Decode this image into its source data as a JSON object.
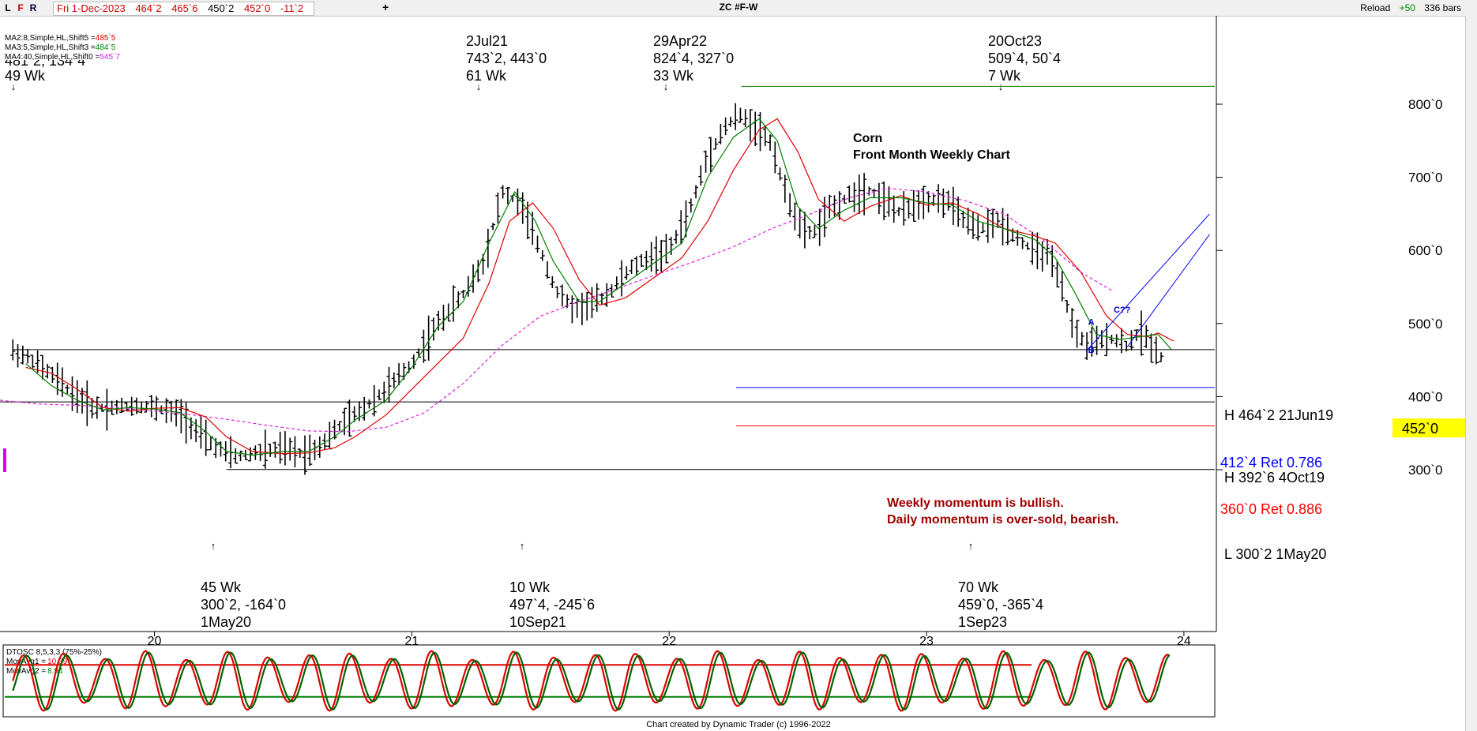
{
  "titlebar": {
    "buttons": [
      "L",
      "F",
      "R"
    ],
    "info": [
      "Fri 1-Dec-2023",
      "464`2",
      "465`6",
      "450`2",
      "452`0",
      "-11`2"
    ],
    "plus": "+",
    "title": "ZC #F-W",
    "reload": "Reload",
    "reload_count": "+50",
    "bars": "336 bars"
  },
  "ma_legend": [
    {
      "label": "MA2:8,Simple,HL,Shift5 =",
      "value": "485`5",
      "color": "#e00000"
    },
    {
      "label": "MA3:5,Simple,HL,Shift3 =",
      "value": "484`5",
      "color": "#008000"
    },
    {
      "label": "MA4:40,Simple,HL,Shift0 =",
      "value": "545`7",
      "color": "#e020e0"
    }
  ],
  "cut_label": "481`2, 134`4",
  "annotations": {
    "peaks": [
      {
        "lines": [
          "49 Wk"
        ]
      },
      {
        "lines": [
          "2Jul21",
          "743`2, 443`0",
          "61 Wk"
        ]
      },
      {
        "lines": [
          "29Apr22",
          "824`4, 327`0",
          "33 Wk"
        ]
      },
      {
        "lines": [
          "20Oct23",
          "509`4, 50`4",
          "7 Wk"
        ]
      }
    ],
    "troughs": [
      {
        "lines": [
          "45 Wk",
          "300`2, -164`0",
          "1May20"
        ]
      },
      {
        "lines": [
          "10 Wk",
          "497`4, -245`6",
          "10Sep21"
        ]
      },
      {
        "lines": [
          "70 Wk",
          "459`0, -365`4",
          "1Sep23"
        ]
      }
    ],
    "chart_text": [
      "Corn",
      "Front Month Weekly Chart"
    ],
    "momentum_text": [
      "Weekly momentum is bullish.",
      "Daily momentum is over-sold, bearish."
    ],
    "abc": [
      "A",
      "B",
      "C??"
    ]
  },
  "levels": [
    {
      "label": "H 464`2 21Jun19",
      "color": "#000000"
    },
    {
      "label": "412`4 Ret 0.786",
      "color": "#0000ff"
    },
    {
      "label": "H 392`6 4Oct19",
      "color": "#000000"
    },
    {
      "label": "360`0 Ret 0.886",
      "color": "#ff0000"
    },
    {
      "label": "L 300`2 1May20",
      "color": "#000000"
    }
  ],
  "price_marker": "452`0",
  "oscillator": {
    "label": "DTOSC 8,5,3,3 (75%-25%)",
    "avg1": {
      "label": "MovAvg1 =",
      "value": "10.39",
      "color": "#e00000"
    },
    "avg2": {
      "label": "MovAvg2 =",
      "value": "8.94",
      "color": "#008000"
    }
  },
  "footer": "Chart created by Dynamic Trader  (c) 1996-2022",
  "chart_data": {
    "type": "bar",
    "title": "ZC #F-W",
    "subtitle": "Corn Front Month Weekly Chart",
    "y_ticks": [
      "300`0",
      "400`0",
      "500`0",
      "600`0",
      "700`0",
      "800`0"
    ],
    "y_tick_values": [
      300,
      400,
      500,
      600,
      700,
      800
    ],
    "ylim": [
      230,
      880
    ],
    "x_labels": [
      "20",
      "21",
      "22",
      "23",
      "24"
    ],
    "x_label_values": [
      2020.0,
      2021.0,
      2022.0,
      2023.0,
      2024.0
    ],
    "xlim": [
      2019.4,
      2024.12
    ],
    "anchors": [
      [
        2019.45,
        462
      ],
      [
        2019.52,
        452
      ],
      [
        2019.6,
        430
      ],
      [
        2019.68,
        405
      ],
      [
        2019.76,
        385
      ],
      [
        2019.84,
        385
      ],
      [
        2019.92,
        388
      ],
      [
        2020.0,
        385
      ],
      [
        2020.1,
        375
      ],
      [
        2020.2,
        340
      ],
      [
        2020.28,
        322
      ],
      [
        2020.33,
        318
      ],
      [
        2020.42,
        325
      ],
      [
        2020.5,
        328
      ],
      [
        2020.58,
        322
      ],
      [
        2020.64,
        332
      ],
      [
        2020.72,
        360
      ],
      [
        2020.8,
        380
      ],
      [
        2020.9,
        410
      ],
      [
        2021.0,
        445
      ],
      [
        2021.1,
        500
      ],
      [
        2021.2,
        540
      ],
      [
        2021.28,
        585
      ],
      [
        2021.35,
        680
      ],
      [
        2021.42,
        665
      ],
      [
        2021.5,
        600
      ],
      [
        2021.56,
        545
      ],
      [
        2021.63,
        520
      ],
      [
        2021.69,
        525
      ],
      [
        2021.76,
        540
      ],
      [
        2021.85,
        575
      ],
      [
        2021.92,
        590
      ],
      [
        2022.0,
        600
      ],
      [
        2022.08,
        655
      ],
      [
        2022.15,
        730
      ],
      [
        2022.22,
        770
      ],
      [
        2022.27,
        785
      ],
      [
        2022.33,
        772
      ],
      [
        2022.4,
        745
      ],
      [
        2022.45,
        680
      ],
      [
        2022.52,
        625
      ],
      [
        2022.57,
        625
      ],
      [
        2022.62,
        655
      ],
      [
        2022.7,
        675
      ],
      [
        2022.78,
        683
      ],
      [
        2022.85,
        665
      ],
      [
        2022.9,
        650
      ],
      [
        2022.95,
        662
      ],
      [
        2023.0,
        670
      ],
      [
        2023.08,
        668
      ],
      [
        2023.15,
        640
      ],
      [
        2023.2,
        628
      ],
      [
        2023.28,
        640
      ],
      [
        2023.36,
        615
      ],
      [
        2023.42,
        598
      ],
      [
        2023.47,
        595
      ],
      [
        2023.52,
        555
      ],
      [
        2023.57,
        495
      ],
      [
        2023.62,
        470
      ],
      [
        2023.67,
        475
      ],
      [
        2023.72,
        480
      ],
      [
        2023.78,
        470
      ],
      [
        2023.83,
        490
      ],
      [
        2023.88,
        468
      ],
      [
        2023.92,
        452
      ]
    ],
    "ma8_shift5": [
      [
        2019.5,
        440
      ],
      [
        2019.6,
        432
      ],
      [
        2019.7,
        410
      ],
      [
        2019.8,
        385
      ],
      [
        2019.9,
        380
      ],
      [
        2020.0,
        384
      ],
      [
        2020.1,
        385
      ],
      [
        2020.2,
        372
      ],
      [
        2020.28,
        345
      ],
      [
        2020.38,
        325
      ],
      [
        2020.5,
        322
      ],
      [
        2020.6,
        323
      ],
      [
        2020.7,
        330
      ],
      [
        2020.78,
        345
      ],
      [
        2020.9,
        375
      ],
      [
        2021.0,
        410
      ],
      [
        2021.1,
        445
      ],
      [
        2021.2,
        480
      ],
      [
        2021.3,
        555
      ],
      [
        2021.38,
        640
      ],
      [
        2021.47,
        665
      ],
      [
        2021.55,
        630
      ],
      [
        2021.65,
        560
      ],
      [
        2021.73,
        525
      ],
      [
        2021.83,
        535
      ],
      [
        2021.95,
        565
      ],
      [
        2022.05,
        590
      ],
      [
        2022.15,
        640
      ],
      [
        2022.25,
        710
      ],
      [
        2022.35,
        765
      ],
      [
        2022.42,
        780
      ],
      [
        2022.5,
        735
      ],
      [
        2022.58,
        670
      ],
      [
        2022.68,
        640
      ],
      [
        2022.78,
        660
      ],
      [
        2022.9,
        675
      ],
      [
        2023.0,
        662
      ],
      [
        2023.1,
        665
      ],
      [
        2023.2,
        650
      ],
      [
        2023.3,
        630
      ],
      [
        2023.42,
        620
      ],
      [
        2023.5,
        610
      ],
      [
        2023.6,
        570
      ],
      [
        2023.7,
        510
      ],
      [
        2023.78,
        485
      ],
      [
        2023.86,
        482
      ],
      [
        2023.9,
        487
      ],
      [
        2023.96,
        476
      ]
    ],
    "ma5_shift3": [
      [
        2019.5,
        445
      ],
      [
        2019.6,
        415
      ],
      [
        2019.7,
        395
      ],
      [
        2019.8,
        382
      ],
      [
        2019.9,
        385
      ],
      [
        2020.0,
        383
      ],
      [
        2020.1,
        378
      ],
      [
        2020.2,
        352
      ],
      [
        2020.28,
        325
      ],
      [
        2020.38,
        320
      ],
      [
        2020.5,
        325
      ],
      [
        2020.6,
        325
      ],
      [
        2020.7,
        345
      ],
      [
        2020.78,
        368
      ],
      [
        2020.9,
        395
      ],
      [
        2021.0,
        440
      ],
      [
        2021.1,
        495
      ],
      [
        2021.2,
        530
      ],
      [
        2021.3,
        610
      ],
      [
        2021.4,
        680
      ],
      [
        2021.48,
        640
      ],
      [
        2021.55,
        585
      ],
      [
        2021.65,
        530
      ],
      [
        2021.73,
        530
      ],
      [
        2021.83,
        555
      ],
      [
        2021.95,
        585
      ],
      [
        2022.05,
        610
      ],
      [
        2022.15,
        700
      ],
      [
        2022.25,
        755
      ],
      [
        2022.35,
        780
      ],
      [
        2022.42,
        750
      ],
      [
        2022.5,
        660
      ],
      [
        2022.58,
        630
      ],
      [
        2022.68,
        655
      ],
      [
        2022.78,
        672
      ],
      [
        2022.9,
        672
      ],
      [
        2023.0,
        665
      ],
      [
        2023.1,
        662
      ],
      [
        2023.2,
        640
      ],
      [
        2023.3,
        630
      ],
      [
        2023.42,
        615
      ],
      [
        2023.5,
        590
      ],
      [
        2023.58,
        540
      ],
      [
        2023.66,
        485
      ],
      [
        2023.75,
        478
      ],
      [
        2023.83,
        482
      ],
      [
        2023.9,
        485
      ],
      [
        2023.95,
        465
      ]
    ],
    "ma40": [
      [
        2019.4,
        395
      ],
      [
        2019.55,
        390
      ],
      [
        2019.7,
        388
      ],
      [
        2019.85,
        385
      ],
      [
        2020.0,
        380
      ],
      [
        2020.15,
        375
      ],
      [
        2020.3,
        368
      ],
      [
        2020.45,
        360
      ],
      [
        2020.6,
        353
      ],
      [
        2020.75,
        352
      ],
      [
        2020.9,
        358
      ],
      [
        2021.05,
        378
      ],
      [
        2021.2,
        418
      ],
      [
        2021.35,
        470
      ],
      [
        2021.5,
        510
      ],
      [
        2021.65,
        530
      ],
      [
        2021.8,
        548
      ],
      [
        2021.95,
        567
      ],
      [
        2022.1,
        585
      ],
      [
        2022.25,
        605
      ],
      [
        2022.4,
        630
      ],
      [
        2022.55,
        650
      ],
      [
        2022.7,
        672
      ],
      [
        2022.85,
        685
      ],
      [
        2023.0,
        680
      ],
      [
        2023.15,
        668
      ],
      [
        2023.3,
        650
      ],
      [
        2023.45,
        615
      ],
      [
        2023.6,
        570
      ],
      [
        2023.72,
        545
      ]
    ],
    "horizontal_lines": [
      {
        "price": 464.25,
        "x_from": 2019.45,
        "color": "#000000"
      },
      {
        "price": 412.5,
        "x_from": 2022.26,
        "color": "#0000ff"
      },
      {
        "price": 392.75,
        "x_from": 2019.4,
        "color": "#000000"
      },
      {
        "price": 360.0,
        "x_from": 2022.26,
        "color": "#ff0000"
      },
      {
        "price": 300.25,
        "x_from": 2020.28,
        "color": "#000000"
      },
      {
        "price": 824.5,
        "x_from": 2022.28,
        "color": "#008000"
      }
    ],
    "channel": [
      {
        "from": [
          2023.62,
          462
        ],
        "to": [
          2024.1,
          650
        ]
      },
      {
        "from": [
          2023.78,
          468
        ],
        "to": [
          2024.1,
          622
        ]
      }
    ],
    "abc_points": [
      [
        2023.64,
        498
      ],
      [
        2023.64,
        460
      ],
      [
        2023.76,
        515
      ]
    ],
    "oscillator_levels": [
      75,
      25
    ],
    "oscillator_ylim": [
      -5,
      105
    ]
  }
}
